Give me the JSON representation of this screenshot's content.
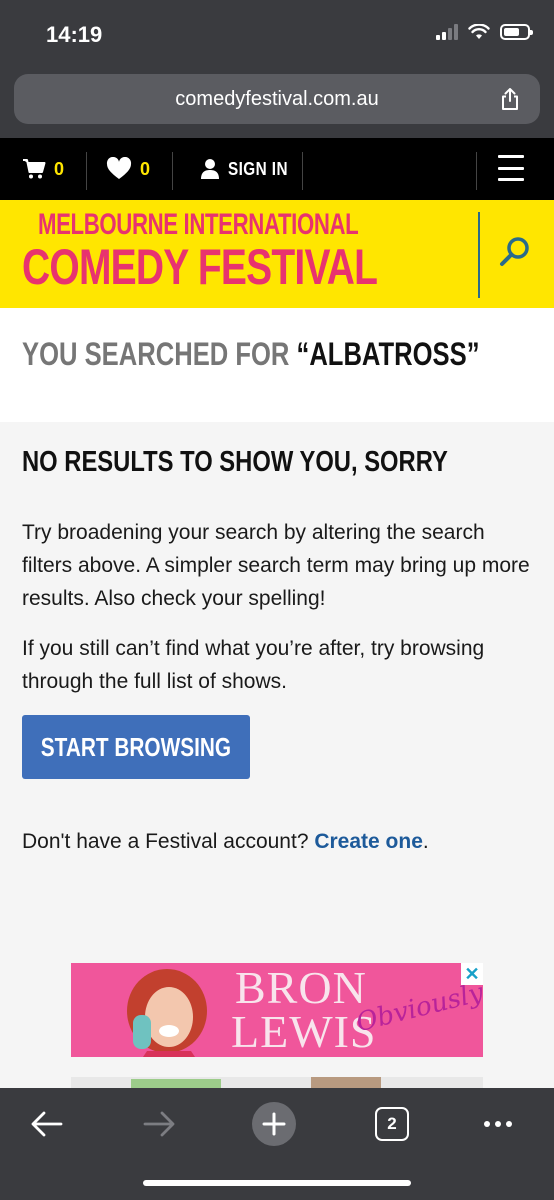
{
  "status_bar": {
    "time": "14:19"
  },
  "browser": {
    "url": "comedyfestival.com.au",
    "tab_count": "2"
  },
  "site_nav": {
    "cart_count": "0",
    "favourites_count": "0",
    "signin_label": "SIGN IN"
  },
  "logo": {
    "line1": "MELBOURNE INTERNATIONAL",
    "line2": "COMEDY FESTIVAL"
  },
  "search": {
    "prefix": "YOU SEARCHED FOR ",
    "term": "“ALBATROSS”"
  },
  "results": {
    "heading": "NO RESULTS TO SHOW YOU, SORRY",
    "paragraph1": "Try broadening your search by altering the search filters above. A simpler search term may bring up more results. Also check your spelling!",
    "paragraph2": "If you still can’t find what you’re after, try browsing through the full list of shows.",
    "browse_button": "START BROWSING",
    "account_prompt": "Don't have a Festival account? ",
    "account_link": "Create one",
    "account_suffix": "."
  },
  "ad": {
    "line1": "BRON",
    "line2": "LEWIS",
    "script": "Obviously",
    "close_glyph": "✕"
  },
  "colors": {
    "brand_yellow": "#ffe600",
    "brand_pink": "#e8336f",
    "button_blue": "#3f6fba",
    "link_blue": "#1d5a9a"
  }
}
